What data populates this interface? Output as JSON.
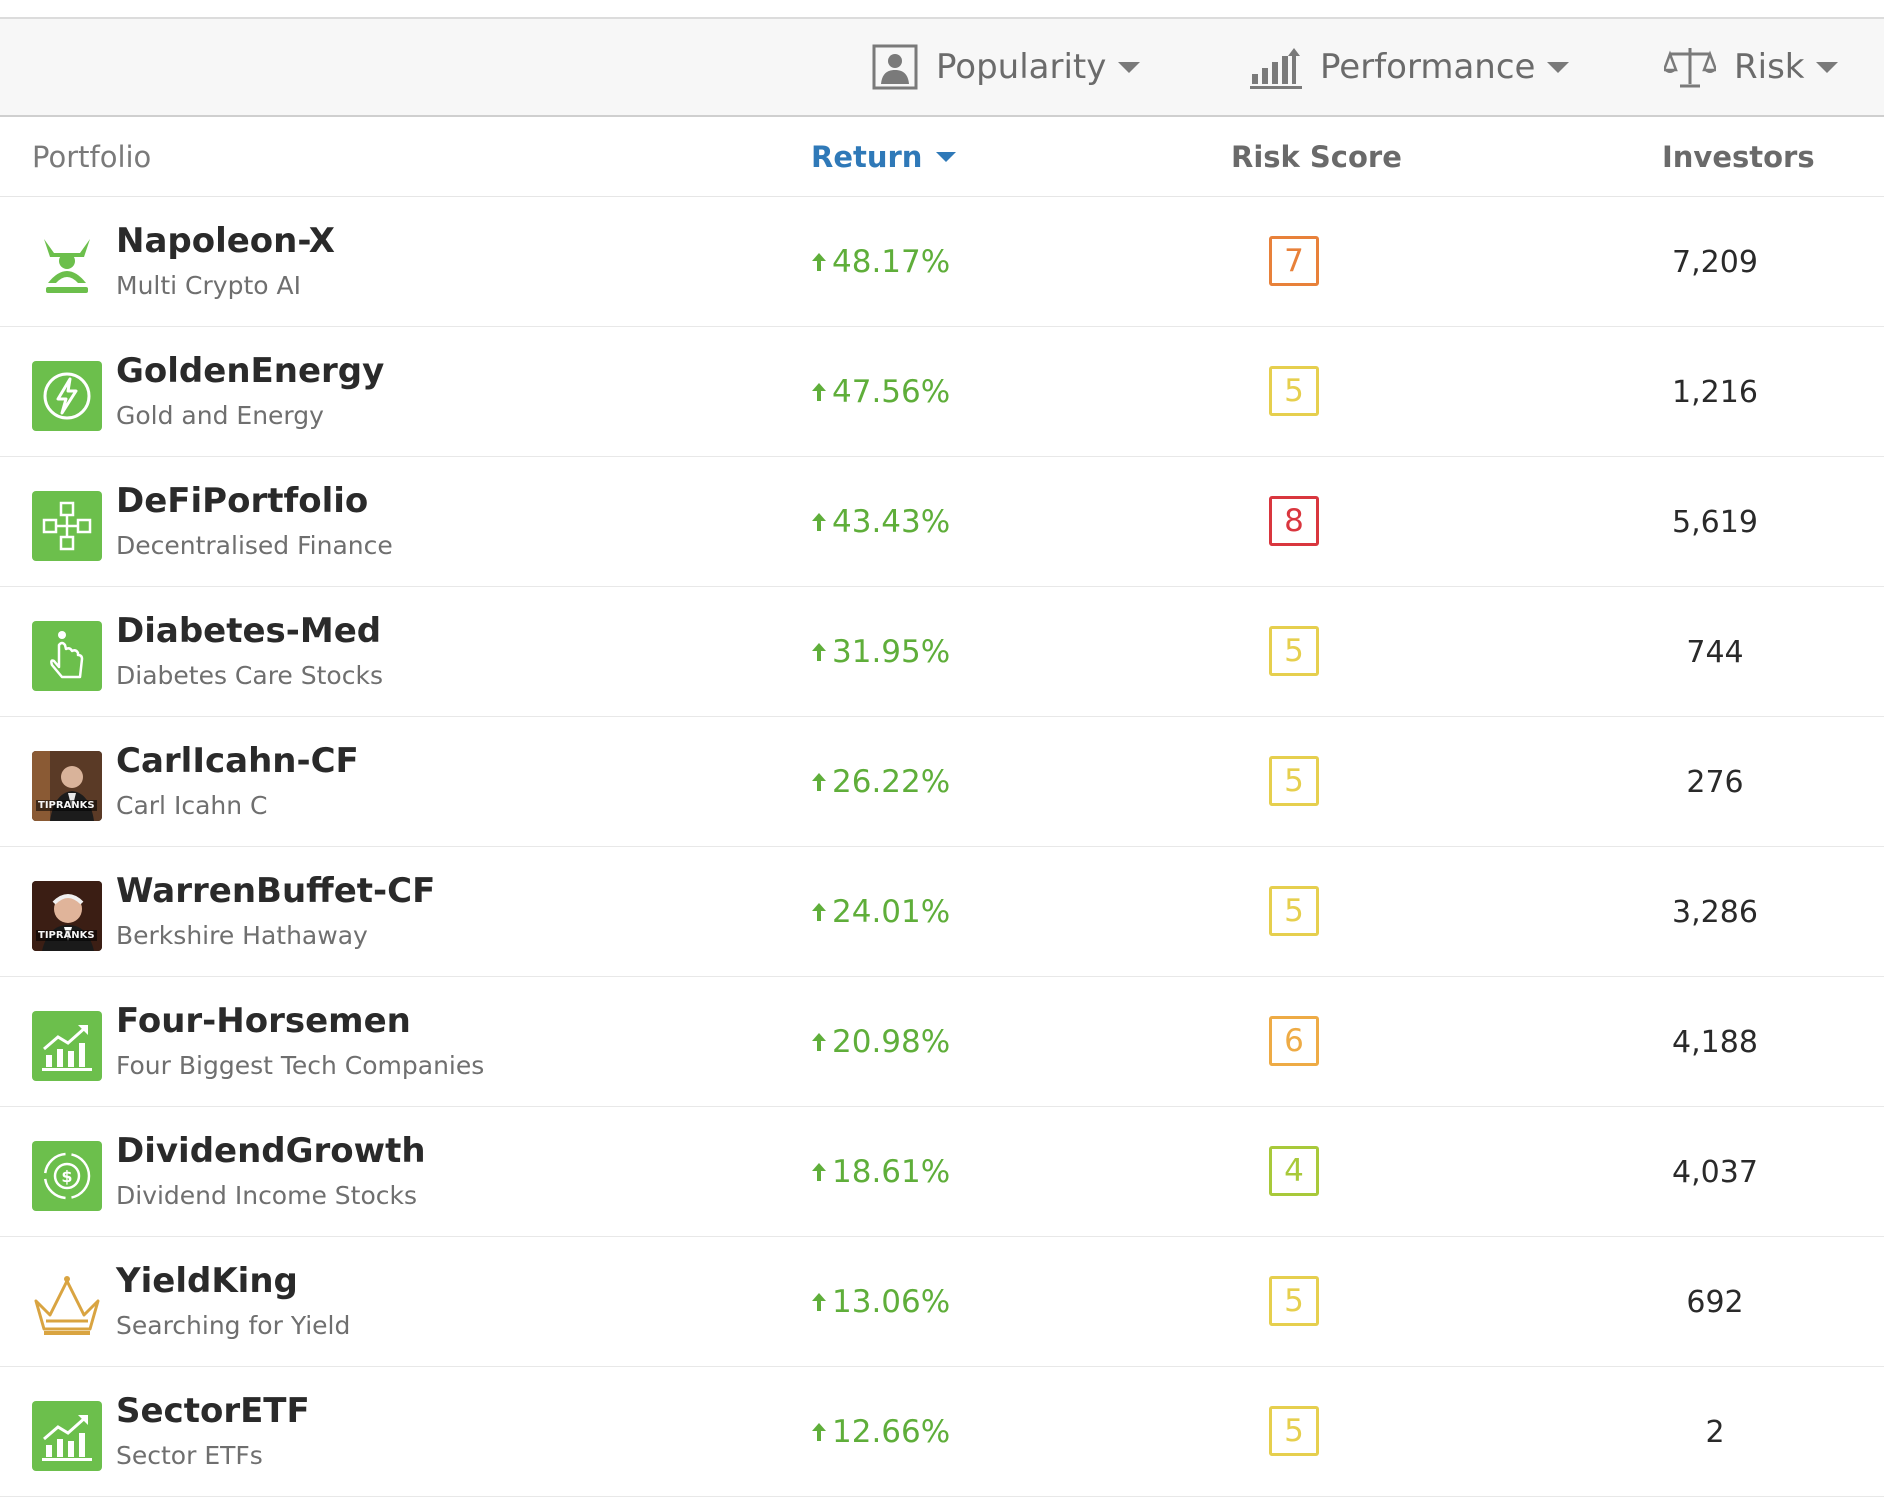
{
  "filters": [
    {
      "label": "Popularity",
      "icon": "person-icon"
    },
    {
      "label": "Performance",
      "icon": "bar-chart-icon"
    },
    {
      "label": "Risk",
      "icon": "scale-icon"
    }
  ],
  "table": {
    "headers": {
      "portfolio": "Portfolio",
      "return": "Return",
      "risk_score": "Risk Score",
      "investors": "Investors"
    },
    "rows": [
      {
        "name": "Napoleon-X",
        "description": "Multi Crypto AI",
        "return": "48.17%",
        "risk": "7",
        "risk_color": "#e8813a",
        "investors": "7,209",
        "icon": "napoleon-x-logo-icon"
      },
      {
        "name": "GoldenEnergy",
        "description": "Gold and Energy",
        "return": "47.56%",
        "risk": "5",
        "risk_color": "#e6cf4e",
        "investors": "1,216",
        "icon": "energy-bolt-icon"
      },
      {
        "name": "DeFiPortfolio",
        "description": "Decentralised Finance",
        "return": "43.43%",
        "risk": "8",
        "risk_color": "#d9363e",
        "investors": "5,619",
        "icon": "blockchain-cubes-icon"
      },
      {
        "name": "Diabetes-Med",
        "description": "Diabetes Care Stocks",
        "return": "31.95%",
        "risk": "5",
        "risk_color": "#e6cf4e",
        "investors": "744",
        "icon": "finger-test-icon"
      },
      {
        "name": "CarlIcahn-CF",
        "description": "Carl Icahn C",
        "return": "26.22%",
        "risk": "5",
        "risk_color": "#e6cf4e",
        "investors": "276",
        "icon": "carl-icahn-photo-icon",
        "badge": "TIPRANKS"
      },
      {
        "name": "WarrenBuffet-CF",
        "description": "Berkshire Hathaway",
        "return": "24.01%",
        "risk": "5",
        "risk_color": "#e6cf4e",
        "investors": "3,286",
        "icon": "warren-buffett-photo-icon",
        "badge": "TIPRANKS"
      },
      {
        "name": "Four-Horsemen",
        "description": "Four Biggest Tech Companies",
        "return": "20.98%",
        "risk": "6",
        "risk_color": "#eeab45",
        "investors": "4,188",
        "icon": "growth-chart-icon"
      },
      {
        "name": "DividendGrowth",
        "description": "Dividend Income Stocks",
        "return": "18.61%",
        "risk": "4",
        "risk_color": "#a8c93a",
        "investors": "4,037",
        "icon": "dollar-coin-icon"
      },
      {
        "name": "YieldKing",
        "description": "Searching for Yield",
        "return": "13.06%",
        "risk": "5",
        "risk_color": "#e6cf4e",
        "investors": "692",
        "icon": "crown-icon"
      },
      {
        "name": "SectorETF",
        "description": "Sector ETFs",
        "return": "12.66%",
        "risk": "5",
        "risk_color": "#e6cf4e",
        "investors": "2",
        "icon": "growth-chart-icon"
      }
    ]
  },
  "colors": {
    "positive_return": "#5fae3a",
    "sort_active": "#2f79b8",
    "icon_green": "#6cbf4c"
  }
}
